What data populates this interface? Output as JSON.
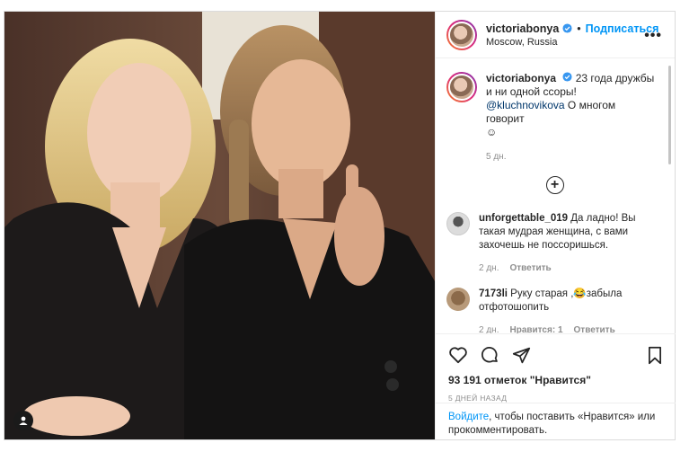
{
  "post": {
    "username": "victoriabonya",
    "separator": "•",
    "follow_label": "Подписаться",
    "location": "Moscow, Russia",
    "more_label": "•••"
  },
  "caption": {
    "username": "victoriabonya",
    "text_before": " 23 года дружбы и ни одной ссоры! ",
    "mention": "@kluchnovikova",
    "text_after": " О многом говорит",
    "emoji": "☺",
    "time": "5 дн."
  },
  "load_more_label": "+",
  "comments": [
    {
      "username": "unforgettable_019",
      "text": " Да ладно! Вы такая мудрая женщина, с вами захочешь не поссоришься.",
      "time": "2 дн.",
      "likes": "",
      "reply_label": "Ответить"
    },
    {
      "username": "7173li",
      "text": " Руку старая ,😂забыла отфотошопить",
      "time": "2 дн.",
      "likes": "Нравится: 1",
      "reply_label": "Ответить"
    }
  ],
  "likes_text": "93 191 отметок \"Нравится\"",
  "posted_ago": "5 ДНЕЙ НАЗАД",
  "login_prompt": {
    "link": "Войдите",
    "text": ", чтобы поставить «Нравится» или прокомментировать."
  },
  "colors": {
    "accent": "#0095f6",
    "border": "#dbdbdb",
    "muted": "#8e8e8e",
    "text": "#262626"
  },
  "icons": [
    "heart-icon",
    "comment-icon",
    "share-icon",
    "bookmark-icon",
    "plus-circle-icon",
    "user-tag-icon",
    "verified-badge-icon"
  ]
}
